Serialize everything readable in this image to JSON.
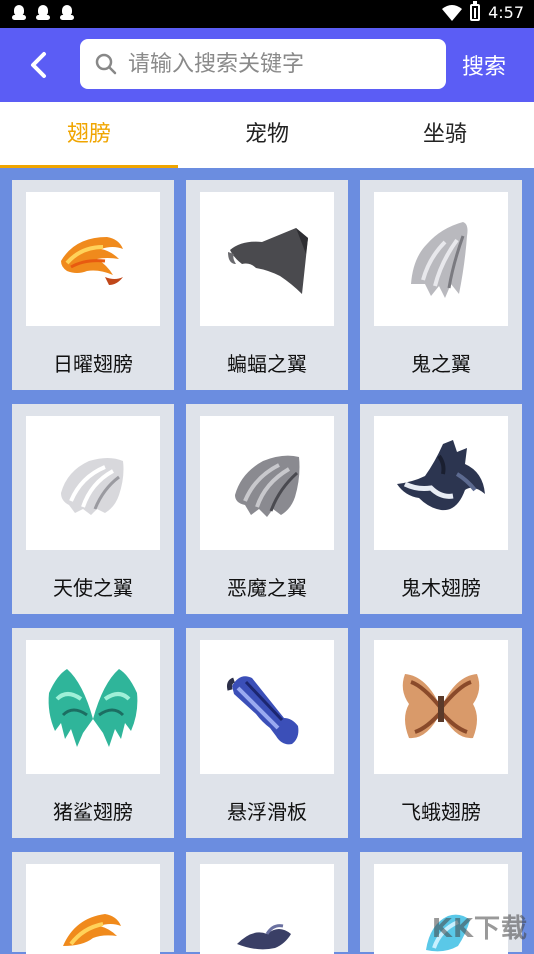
{
  "status_bar": {
    "time": "4:57"
  },
  "header": {
    "search_placeholder": "请输入搜索关键字",
    "search_button": "搜索"
  },
  "tabs": [
    {
      "label": "翅膀",
      "active": true
    },
    {
      "label": "宠物",
      "active": false
    },
    {
      "label": "坐骑",
      "active": false
    }
  ],
  "items": [
    {
      "name": "日曜翅膀",
      "icon": "sun-wings-icon"
    },
    {
      "name": "蝙蝠之翼",
      "icon": "bat-wings-icon"
    },
    {
      "name": "鬼之翼",
      "icon": "ghost-wings-icon"
    },
    {
      "name": "天使之翼",
      "icon": "angel-wings-icon"
    },
    {
      "name": "恶魔之翼",
      "icon": "demon-wings-icon"
    },
    {
      "name": "鬼木翅膀",
      "icon": "spooky-wings-icon"
    },
    {
      "name": "猪鲨翅膀",
      "icon": "fishron-wings-icon"
    },
    {
      "name": "悬浮滑板",
      "icon": "hoverboard-icon"
    },
    {
      "name": "飞蛾翅膀",
      "icon": "moth-wings-icon"
    }
  ],
  "colors": {
    "accent": "#f0a500",
    "header": "#5b5df5",
    "background": "#6b8de0"
  },
  "watermark": "KK下载"
}
